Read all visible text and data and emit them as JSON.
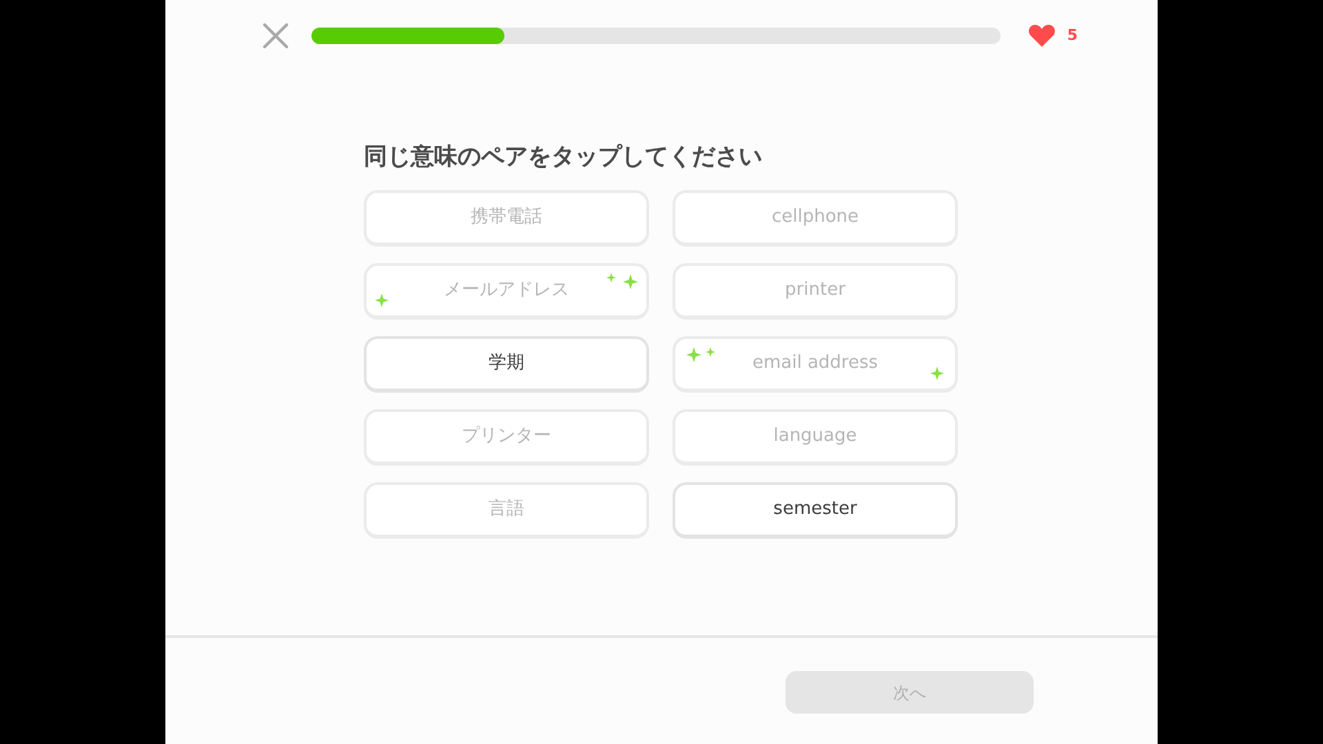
{
  "progress": {
    "level": 0.28
  },
  "hearts": {
    "count": "5"
  },
  "prompt": "同じ意味のペアをタップしてください",
  "columns": [
    {
      "cards": [
        {
          "text": "携帯電話",
          "matched": true,
          "sparkles": false
        },
        {
          "text": "メールアドレス",
          "matched": true,
          "sparkles": true
        },
        {
          "text": "学期",
          "matched": false,
          "sparkles": false
        },
        {
          "text": "プリンター",
          "matched": true,
          "sparkles": false
        },
        {
          "text": "言語",
          "matched": true,
          "sparkles": false
        }
      ]
    },
    {
      "cards": [
        {
          "text": "cellphone",
          "matched": true,
          "sparkles": false
        },
        {
          "text": "printer",
          "matched": true,
          "sparkles": false
        },
        {
          "text": "email address",
          "matched": true,
          "sparkles": true
        },
        {
          "text": "language",
          "matched": true,
          "sparkles": false
        },
        {
          "text": "semester",
          "matched": false,
          "sparkles": false
        }
      ]
    }
  ],
  "next_button": {
    "label": "次へ",
    "disabled": true
  }
}
